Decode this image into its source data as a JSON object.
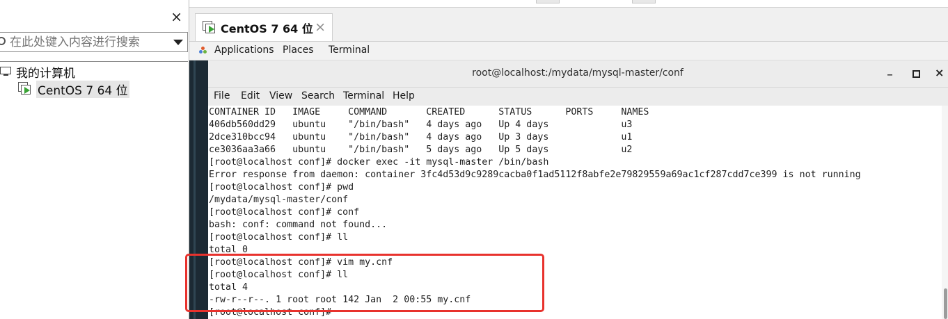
{
  "library": {
    "close_glyph": "×",
    "search_placeholder": "在此处键入内容进行搜索",
    "tree": {
      "root_label": "我的计算机",
      "vm_label": "CentOS 7 64 位"
    }
  },
  "tab": {
    "title": "CentOS 7 64 位",
    "close_glyph": "×"
  },
  "gnome_bar": {
    "applications": "Applications",
    "places": "Places",
    "terminal": "Terminal"
  },
  "terminal": {
    "title": "root@localhost:/mydata/mysql-master/conf",
    "controls": {
      "minimize": "_",
      "close": "×"
    },
    "menu": [
      "File",
      "Edit",
      "View",
      "Search",
      "Terminal",
      "Help"
    ],
    "lines": [
      "CONTAINER ID   IMAGE     COMMAND       CREATED      STATUS      PORTS     NAMES",
      "406db560dd29   ubuntu    \"/bin/bash\"   4 days ago   Up 4 days             u3",
      "2dce310bcc94   ubuntu    \"/bin/bash\"   4 days ago   Up 3 days             u1",
      "ce3036aa3a66   ubuntu    \"/bin/bash\"   5 days ago   Up 5 days             u2",
      "[root@localhost conf]# docker exec -it mysql-master /bin/bash",
      "Error response from daemon: container 3fc4d53d9c9289cacba0f1ad5112f8abfe2e79829559a69ac1cf287cdd7ce399 is not running",
      "[root@localhost conf]# pwd",
      "/mydata/mysql-master/conf",
      "[root@localhost conf]# conf",
      "bash: conf: command not found...",
      "[root@localhost conf]# ll",
      "total 0",
      "[root@localhost conf]# vim my.cnf",
      "[root@localhost conf]# ll",
      "total 4",
      "-rw-r--r--. 1 root root 142 Jan  2 00:55 my.cnf",
      "[root@localhost conf]# "
    ]
  },
  "colors": {
    "highlight": "#e8322d",
    "dark_edge": "#1c2a34",
    "play_icon": "#3aa336"
  }
}
